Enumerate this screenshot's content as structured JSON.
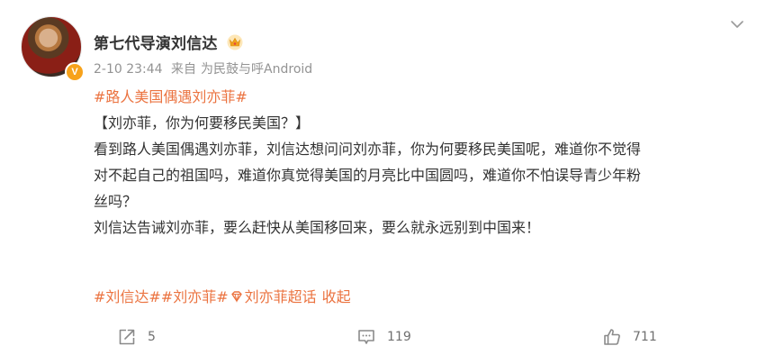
{
  "post": {
    "username": "第七代导演刘信达",
    "time": "2-10 23:44",
    "source_prefix": "来自",
    "source": "为民鼓与呼Android",
    "topic": "#路人美国偶遇刘亦菲#",
    "lines": [
      "【刘亦菲，你为何要移民美国？】",
      "看到路人美国偶遇刘亦菲，刘信达想问问刘亦菲，你为何要移民美国呢，难道你不觉得",
      "对不起自己的祖国吗，难道你真觉得美国的月亮比中国圆吗，难道你不怕误导青少年粉",
      "丝吗？",
      "刘信达告诫刘亦菲，要么赶快从美国移回来，要么就永远别到中国来！"
    ],
    "tags": {
      "tag1": "#刘信达#",
      "tag2": "#刘亦菲#",
      "super_topic": "刘亦菲超话",
      "collapse": "收起"
    }
  },
  "actions": {
    "share_count": "5",
    "comment_count": "119",
    "like_count": "711"
  },
  "colors": {
    "accent": "#eb7340",
    "meta": "#939393",
    "text": "#333333",
    "badge": "#f7a21b"
  },
  "icons": [
    "crown-icon",
    "chevron-down-icon",
    "verified-badge-icon",
    "diamond-icon",
    "share-icon",
    "comment-icon",
    "like-icon"
  ]
}
